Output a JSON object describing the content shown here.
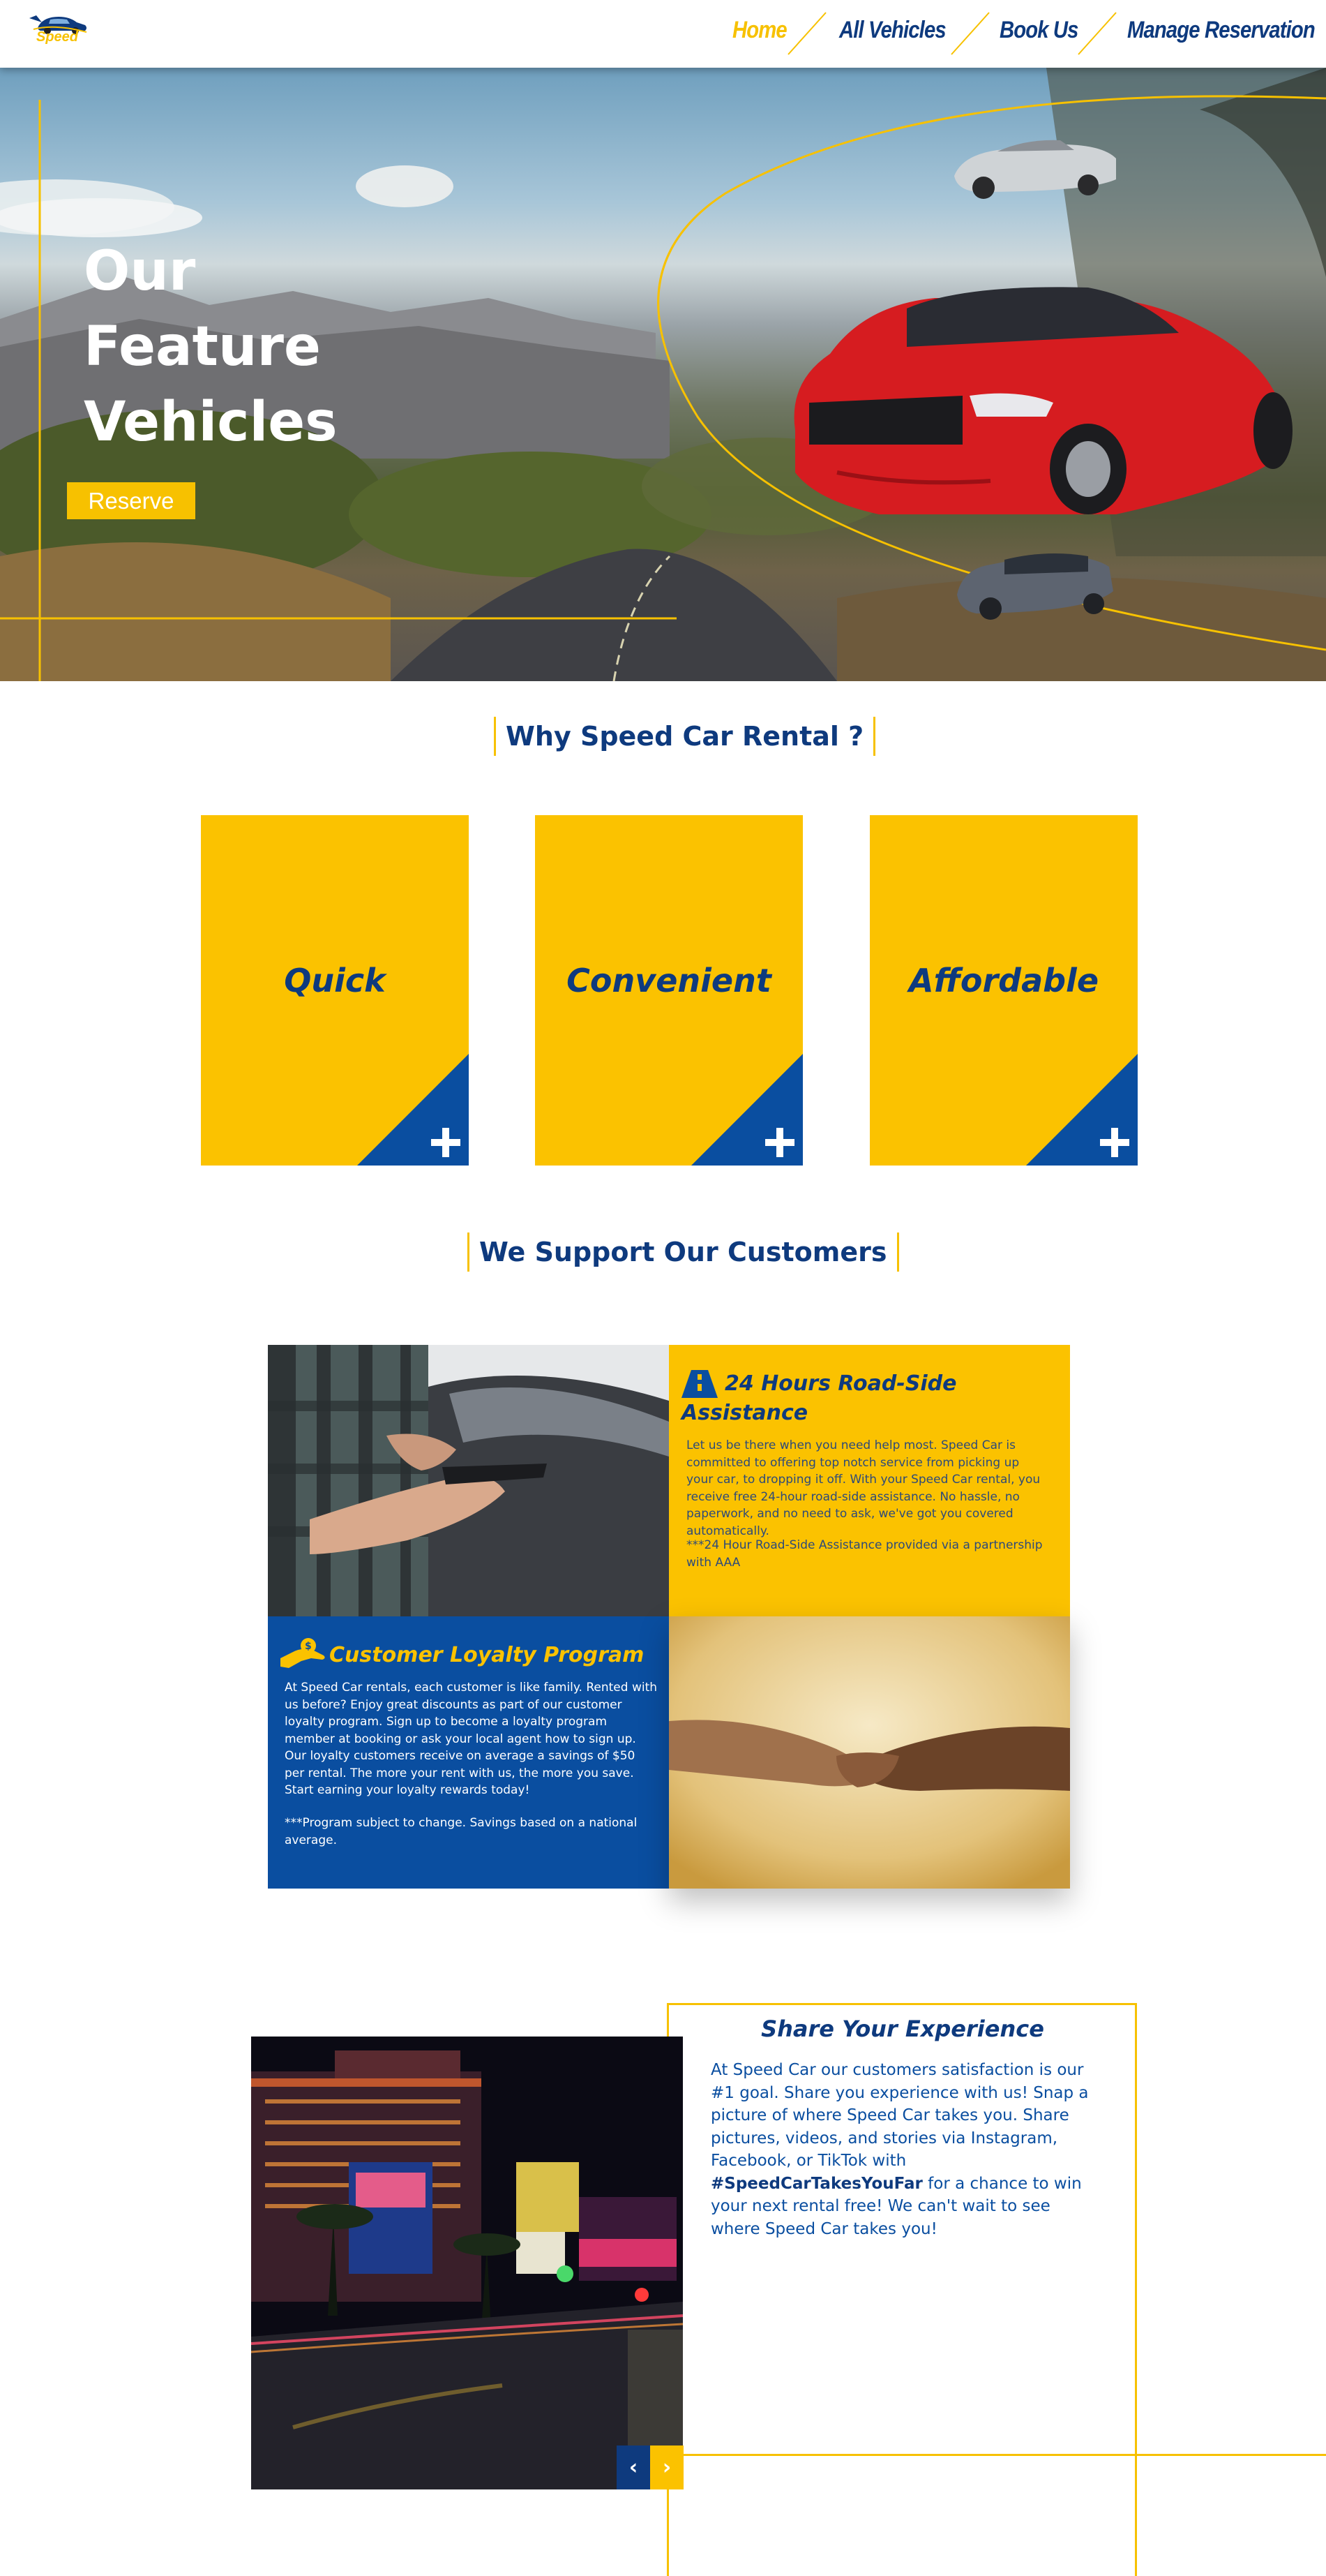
{
  "nav": {
    "logo_text": "Speed",
    "items": [
      {
        "label": "Home",
        "active": true
      },
      {
        "label": "All Vehicles",
        "active": false
      },
      {
        "label": "Book Us",
        "active": false
      },
      {
        "label": "Manage Reservation",
        "active": false
      }
    ]
  },
  "hero": {
    "title_line1": "Our",
    "title_line2": "Feature",
    "title_line3": "Vehicles",
    "reserve_label": "Reserve"
  },
  "why": {
    "heading": "Why Speed Car Rental ?",
    "cards": [
      {
        "label": "Quick",
        "icon": "plus-icon"
      },
      {
        "label": "Convenient",
        "icon": "plus-icon"
      },
      {
        "label": "Affordable",
        "icon": "plus-icon"
      }
    ]
  },
  "support": {
    "heading": "We Support Our Customers",
    "roadside": {
      "icon": "road-icon",
      "title_line1": "24 Hours Road-Side",
      "title_line2": "Assistance",
      "body": "Let us be there when you need help most. Speed Car is committed to offering top notch service from picking up your car, to dropping it off. With your Speed Car rental, you receive free 24-hour road-side assistance. No hassle, no paperwork, and no need to ask, we've got you covered automatically.",
      "note": "***24 Hour Road-Side Assistance provided via a partnership with AAA"
    },
    "loyalty": {
      "icon": "hand-holding-dollar-icon",
      "title": "Customer Loyalty Program",
      "body": "At Speed Car rentals, each customer is like family. Rented with us before? Enjoy great discounts as part of our customer loyalty program. Sign up to become a loyalty program member at booking or ask your local agent how to sign up. Our loyalty customers receive on average a savings of $50 per rental. The more your rent with us, the more you save. Start earning your loyalty rewards today!",
      "note": "***Program subject to change. Savings based on a national average."
    }
  },
  "share": {
    "title": "Share Your Experience",
    "body_before": "At Speed Car our customers satisfaction is our #1 goal. Share you experience with us! Snap a picture of where Speed Car takes you. Share pictures, videos, and stories via Instagram, Facebook, or TikTok with ",
    "hashtag": "#SpeedCarTakesYouFar",
    "body_after": " for a chance to win your next rental free! We can't wait to see where Speed Car takes you!",
    "prev_icon": "chevron-left-icon",
    "next_icon": "chevron-right-icon"
  },
  "colors": {
    "brand_yellow": "#fbc200",
    "brand_blue": "#0a4ea0",
    "navy": "#0e3a7e"
  }
}
